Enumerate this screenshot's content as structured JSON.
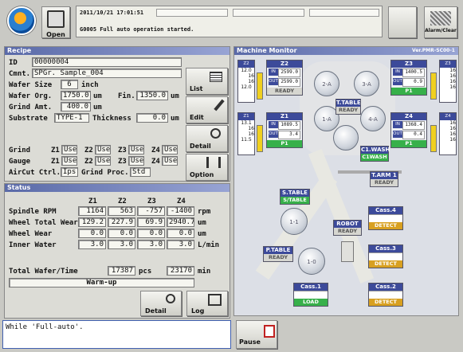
{
  "topbar": {
    "open_label": "Open",
    "timestamp": "2011/10/21 17:01:51",
    "message": "G0005  Full auto operation started.",
    "alarm_label": "Alarm/Clear"
  },
  "recipe": {
    "header": "Recipe",
    "id_label": "ID",
    "id_value": "00000004",
    "cmnt_label": "Cmnt.",
    "cmnt_value": "SPGr. Sample_004",
    "wafer_size_label": "Wafer Size",
    "wafer_size_value": "6",
    "wafer_size_unit": "inch",
    "wafer_org_label": "Wafer Org.",
    "wafer_org_value": "1750.0",
    "wafer_org_unit": "um",
    "fin_label": "Fin.",
    "fin_value": "1350.0",
    "fin_unit": "um",
    "grind_amt_label": "Grind Amt.",
    "grind_amt_value": "400.0",
    "grind_amt_unit": "um",
    "substrate_label": "Substrate",
    "substrate_value": "TYPE-1",
    "thickness_label": "Thickness",
    "thickness_value": "0.0",
    "thickness_unit": "um",
    "grind_label": "Grind",
    "gauge_label": "Gauge",
    "grind_zones": [
      {
        "zone": "Z1",
        "value": "Use"
      },
      {
        "zone": "Z2",
        "value": "Use"
      },
      {
        "zone": "Z3",
        "value": "Use"
      },
      {
        "zone": "Z4",
        "value": "Use"
      }
    ],
    "gauge_zones": [
      {
        "zone": "Z1",
        "value": "Use"
      },
      {
        "zone": "Z2",
        "value": "Use"
      },
      {
        "zone": "Z3",
        "value": "Use"
      },
      {
        "zone": "Z4",
        "value": "Use"
      }
    ],
    "aircut_label": "AirCut Ctrl.",
    "aircut_value": "Ips",
    "grind_proc_label": "Grind Proc.",
    "grind_proc_value": "Std",
    "buttons": {
      "list": "List",
      "edit": "Edit",
      "detail": "Detail",
      "option": "Option"
    }
  },
  "status": {
    "header": "Status",
    "columns": [
      "Z1",
      "Z2",
      "Z3",
      "Z4"
    ],
    "rows": [
      {
        "label": "Spindle RPM",
        "values": [
          "1164",
          "563",
          "-757",
          "-1400"
        ],
        "unit": "rpm"
      },
      {
        "label": "Wheel Total Wear",
        "values": [
          "129.2",
          "227.9",
          "69.9",
          "2940.7"
        ],
        "unit": "um"
      },
      {
        "label": "Wheel Wear",
        "values": [
          "0.0",
          "0.0",
          "0.0",
          "0.0"
        ],
        "unit": "um"
      },
      {
        "label": "Inner Water",
        "values": [
          "3.0",
          "3.0",
          "3.0",
          "3.0"
        ],
        "unit": "L/min"
      }
    ],
    "total_label": "Total Wafer/Time",
    "total_pcs": "17387",
    "pcs_unit": "pcs",
    "total_min": "23170",
    "min_unit": "min",
    "warmup": "Warm-up",
    "detail_btn": "Detail",
    "log_btn": "Log"
  },
  "message_box": {
    "text": "While 'Full-auto'."
  },
  "pause_label": "Pause",
  "monitor": {
    "header": "Machine Monitor",
    "version": "Ver.PMR-SC00-1",
    "zones": [
      {
        "name": "Z2",
        "in_label": "IN",
        "in_value": "2599.0",
        "out_label": "OUT",
        "out_value": "2599.0",
        "state": "READY",
        "gauge": [
          "12.0",
          "16",
          "16",
          "12.0"
        ]
      },
      {
        "name": "Z3",
        "in_label": "IN",
        "in_value": "1400.5",
        "out_label": "OUT",
        "out_value": "0.9",
        "state": "P1",
        "gauge": [
          "16",
          "16",
          "16",
          "16"
        ]
      },
      {
        "name": "Z1",
        "in_label": "IN",
        "in_value": "1089.5",
        "out_label": "OUT",
        "out_value": "3.4",
        "state": "P1",
        "gauge": [
          "13.1",
          "16",
          "16",
          "11.5"
        ]
      },
      {
        "name": "Z4",
        "in_label": "IN",
        "in_value": "1368.4",
        "out_label": "OUT",
        "out_value": "0.4",
        "state": "P1",
        "gauge": [
          "16",
          "16",
          "16",
          "16"
        ]
      }
    ],
    "wafer_labels": [
      "2-A",
      "3-A",
      "1-A",
      "4-A"
    ],
    "t_table": {
      "name": "T.TABLE",
      "state": "READY"
    },
    "c_wash": {
      "name": "C1.WASH",
      "state": "C1WASH"
    },
    "t_arm": {
      "name": "T.ARM 1",
      "state": "READY"
    },
    "s_table": {
      "name": "S.TABLE",
      "state": "S/TABLE",
      "wafer": "1-1"
    },
    "p_table": {
      "name": "P.TABLE",
      "state": "READY",
      "wafer": "1-0"
    },
    "robot": {
      "name": "ROBOT",
      "state": "READY"
    },
    "cassettes": [
      {
        "name": "Cass.4",
        "state": "DETECT"
      },
      {
        "name": "Cass.3",
        "state": "DETECT"
      },
      {
        "name": "Cass.2",
        "state": "DETECT"
      },
      {
        "name": "Cass.1",
        "state": "LOAD"
      }
    ]
  }
}
